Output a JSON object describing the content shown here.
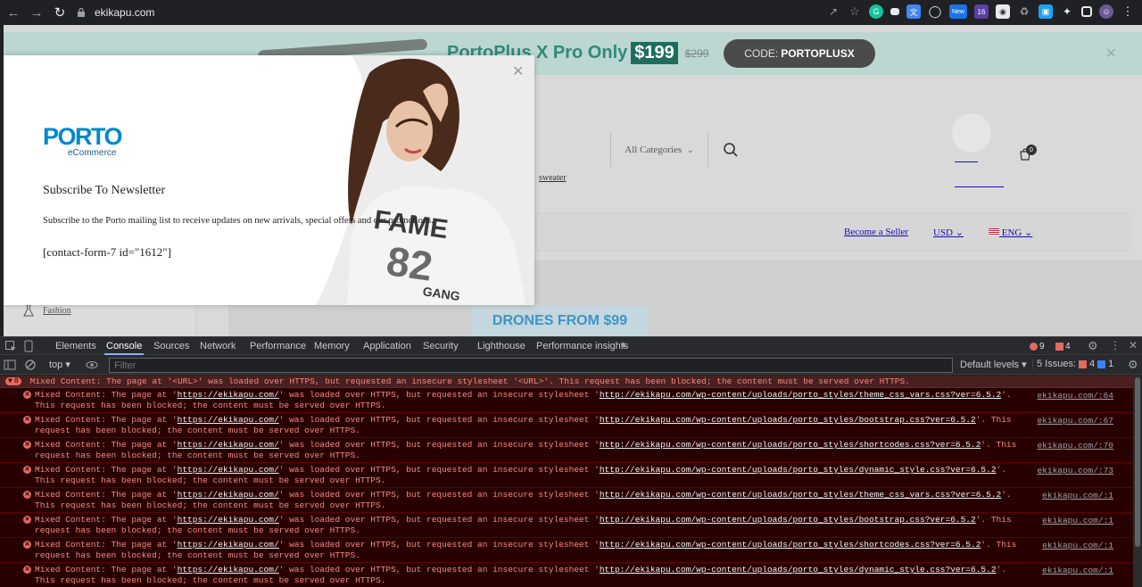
{
  "browser": {
    "url": "ekikapu.com",
    "extensions": [
      "share-icon",
      "star-icon",
      "grammarly-icon",
      "ext-dark-icon",
      "translate-icon",
      "globe-icon",
      "new-badge-icon",
      "ext-16-icon",
      "camera-icon",
      "recycle-icon",
      "ext-blue-icon",
      "puzzle-icon",
      "sidebar-icon",
      "profile-avatar",
      "menu-icon"
    ],
    "new_label": "New",
    "count_label": "16"
  },
  "site": {
    "promo": {
      "headline": "PortoPlus X Pro Only",
      "price": "$199",
      "old_price": "$299",
      "code_prefix": "CODE:",
      "code": "PORTOPLUSX"
    },
    "category_select": "All Categories",
    "keyword": "sweater",
    "cart_count": "0",
    "nav": {
      "become_seller": "Become a Seller",
      "currency": "USD",
      "language": "ENG"
    },
    "sidebar_item": "Fashion",
    "banner": "DRONES FROM $99",
    "colors": {
      "teal": "#2f8a7a",
      "brand_blue": "#0088cc"
    }
  },
  "modal": {
    "logo_word": "PORTO",
    "logo_sub": "eCommerce",
    "title": "Subscribe To Newsletter",
    "description": "Subscribe to the Porto mailing list to receive updates on new arrivals, special offers and our promotions.",
    "shortcode": "[contact-form-7 id=\"1612\"]"
  },
  "devtools": {
    "tabs": [
      "Elements",
      "Console",
      "Sources",
      "Network",
      "Performance",
      "Memory",
      "Application",
      "Security",
      "Lighthouse",
      "Performance insights"
    ],
    "active_tab": "Console",
    "error_count": "9",
    "warning_count": "4",
    "context": "top",
    "filter_placeholder": "Filter",
    "levels": "Default levels",
    "issues_label": "5 Issues:",
    "issues_errors": "4",
    "issues_info": "1",
    "group": {
      "count": "8",
      "text": "Mixed Content: The page at '<URL>' was loaded over HTTPS, but requested an insecure stylesheet '<URL>'. This request has been blocked; the content must be served over HTTPS."
    },
    "messages": [
      {
        "pre": "Mixed Content: The page at '",
        "page": "https://ekikapu.com/",
        "mid": "' was loaded over HTTPS, but requested an insecure stylesheet '",
        "res": "http://ekikapu.com/wp-content/uploads/porto_styles/theme_css_vars.css?ver=6.5.2",
        "post": "'. This request has been blocked; the content must be served over HTTPS.",
        "src": "ekikapu.com/:64"
      },
      {
        "pre": "Mixed Content: The page at '",
        "page": "https://ekikapu.com/",
        "mid": "' was loaded over HTTPS, but requested an insecure stylesheet '",
        "res": "http://ekikapu.com/wp-content/uploads/porto_styles/bootstrap.css?ver=6.5.2",
        "post": "'. This request has been blocked; the content must be served over HTTPS.",
        "src": "ekikapu.com/:67"
      },
      {
        "pre": "Mixed Content: The page at '",
        "page": "https://ekikapu.com/",
        "mid": "' was loaded over HTTPS, but requested an insecure stylesheet '",
        "res": "http://ekikapu.com/wp-content/uploads/porto_styles/shortcodes.css?ver=6.5.2",
        "post": "'. This request has been blocked; the content must be served over HTTPS.",
        "src": "ekikapu.com/:70"
      },
      {
        "pre": "Mixed Content: The page at '",
        "page": "https://ekikapu.com/",
        "mid": "' was loaded over HTTPS, but requested an insecure stylesheet '",
        "res": "http://ekikapu.com/wp-content/uploads/porto_styles/dynamic_style.css?ver=6.5.2",
        "post": "'. This request has been blocked; the content must be served over HTTPS.",
        "src": "ekikapu.com/:73"
      },
      {
        "pre": "Mixed Content: The page at '",
        "page": "https://ekikapu.com/",
        "mid": "' was loaded over HTTPS, but requested an insecure stylesheet '",
        "res": "http://ekikapu.com/wp-content/uploads/porto_styles/theme_css_vars.css?ver=6.5.2",
        "post": "'. This request has been blocked; the content must be served over HTTPS.",
        "src": "ekikapu.com/:1"
      },
      {
        "pre": "Mixed Content: The page at '",
        "page": "https://ekikapu.com/",
        "mid": "' was loaded over HTTPS, but requested an insecure stylesheet '",
        "res": "http://ekikapu.com/wp-content/uploads/porto_styles/bootstrap.css?ver=6.5.2",
        "post": "'. This request has been blocked; the content must be served over HTTPS.",
        "src": "ekikapu.com/:1"
      },
      {
        "pre": "Mixed Content: The page at '",
        "page": "https://ekikapu.com/",
        "mid": "' was loaded over HTTPS, but requested an insecure stylesheet '",
        "res": "http://ekikapu.com/wp-content/uploads/porto_styles/shortcodes.css?ver=6.5.2",
        "post": "'. This request has been blocked; the content must be served over HTTPS.",
        "src": "ekikapu.com/:1"
      },
      {
        "pre": "Mixed Content: The page at '",
        "page": "https://ekikapu.com/",
        "mid": "' was loaded over HTTPS, but requested an insecure stylesheet '",
        "res": "http://ekikapu.com/wp-content/uploads/porto_styles/dynamic_style.css?ver=6.5.2",
        "post": "'. This request has been blocked; the content must be served over HTTPS.",
        "src": "ekikapu.com/:1"
      }
    ]
  }
}
